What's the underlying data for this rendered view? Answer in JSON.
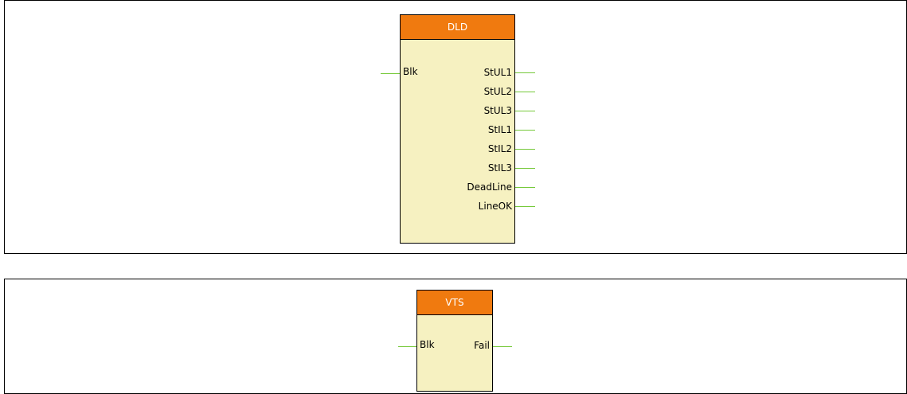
{
  "blocks": {
    "dld": {
      "title": "DLD",
      "inputs": [
        "Blk"
      ],
      "outputs": [
        "StUL1",
        "StUL2",
        "StUL3",
        "StIL1",
        "StIL2",
        "StIL3",
        "DeadLine",
        "LineOK"
      ]
    },
    "vts": {
      "title": "VTS",
      "inputs": [
        "Blk"
      ],
      "outputs": [
        "Fail"
      ]
    }
  },
  "colors": {
    "header": "#f07a0f",
    "body": "#f6f1c1",
    "connector": "#76c93a",
    "border": "#000000"
  }
}
